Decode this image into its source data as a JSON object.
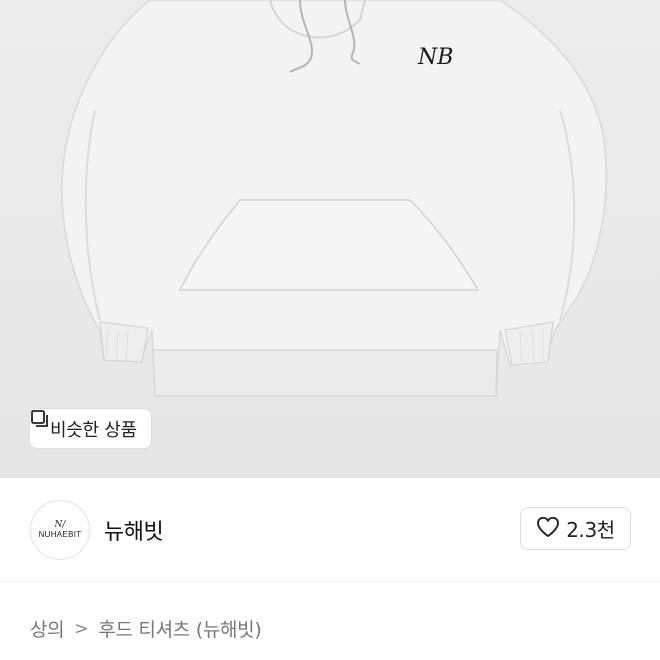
{
  "product_image": {
    "alt_subject": "hoodie",
    "logo_text": "NB"
  },
  "similar_button": {
    "label": "비슷한 상품",
    "icon": "similar-items-icon"
  },
  "shop": {
    "avatar_mark": "N/",
    "avatar_text": "NUHAEBIT",
    "name": "뉴해빗"
  },
  "like": {
    "icon": "heart-icon",
    "count": "2.3천"
  },
  "breadcrumb": {
    "category": "상의",
    "separator": ">",
    "item": "후드 티셔츠 (뉴해빗)"
  },
  "colors": {
    "image_bg": "#e8e8e8",
    "text_primary": "#111111",
    "text_secondary": "#777777",
    "border": "#dcdcdc"
  }
}
